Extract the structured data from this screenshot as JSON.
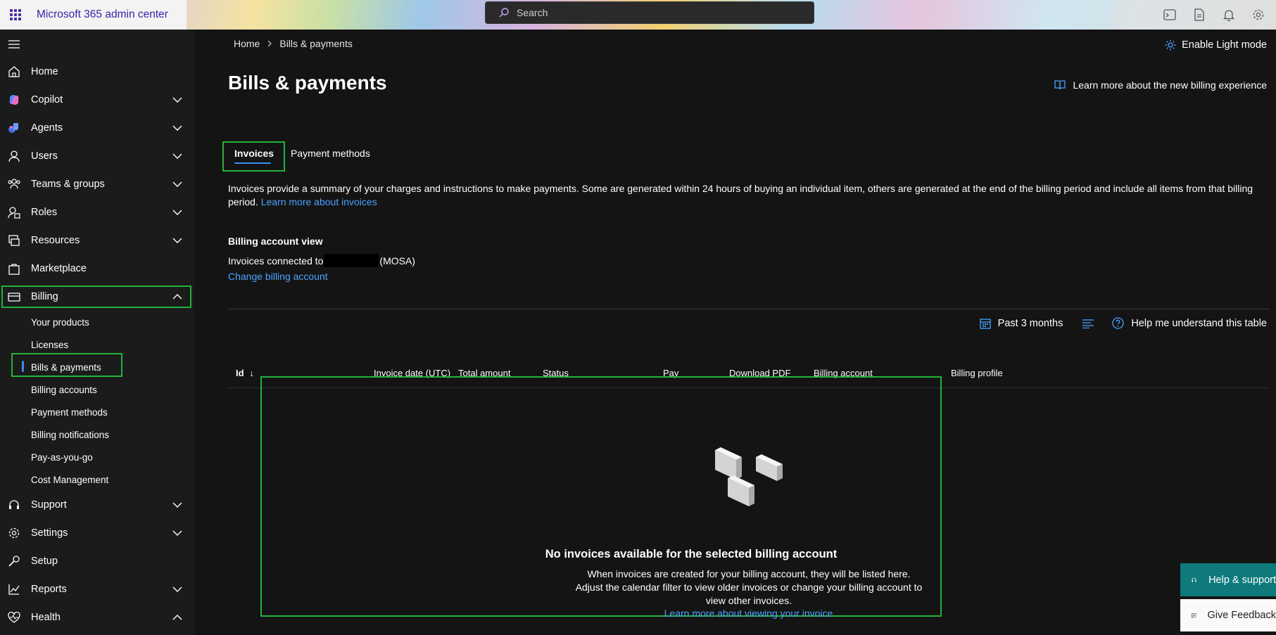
{
  "app": {
    "title": "Microsoft 365 admin center"
  },
  "search": {
    "placeholder": "Search"
  },
  "sidebar": {
    "items": [
      {
        "label": "Home"
      },
      {
        "label": "Copilot"
      },
      {
        "label": "Agents"
      },
      {
        "label": "Users"
      },
      {
        "label": "Teams & groups"
      },
      {
        "label": "Roles"
      },
      {
        "label": "Resources"
      },
      {
        "label": "Marketplace"
      },
      {
        "label": "Billing"
      },
      {
        "label": "Support"
      },
      {
        "label": "Settings"
      },
      {
        "label": "Setup"
      },
      {
        "label": "Reports"
      },
      {
        "label": "Health"
      }
    ],
    "billing_sub": [
      {
        "label": "Your products"
      },
      {
        "label": "Licenses"
      },
      {
        "label": "Bills & payments"
      },
      {
        "label": "Billing accounts"
      },
      {
        "label": "Payment methods"
      },
      {
        "label": "Billing notifications"
      },
      {
        "label": "Pay-as-you-go"
      },
      {
        "label": "Cost Management"
      }
    ]
  },
  "breadcrumb": {
    "home": "Home",
    "current": "Bills & payments"
  },
  "header": {
    "light_mode": "Enable Light mode",
    "learn_more_billing": "Learn more about the new billing experience",
    "title": "Bills & payments"
  },
  "tabs": [
    {
      "label": "Invoices",
      "selected": true
    },
    {
      "label": "Payment methods",
      "selected": false
    }
  ],
  "description": {
    "text": "Invoices provide a summary of your charges and instructions to make payments. Some are generated within 24 hours of buying an individual item, others are generated at the end of the billing period and include all items from that billing period. ",
    "link": "Learn more about invoices"
  },
  "account_view": {
    "title": "Billing account view",
    "prefix": "Invoices connected to",
    "suffix": "(MOSA)",
    "change_link": "Change billing account"
  },
  "filters": {
    "date_range": "Past 3 months",
    "help": "Help me understand this table"
  },
  "table": {
    "columns": [
      "Id",
      "Invoice date (UTC)",
      "Total amount",
      "Status",
      "Pay",
      "Download PDF",
      "Billing account",
      "Billing profile"
    ]
  },
  "empty_state": {
    "title": "No invoices available for the selected billing account",
    "text": "When invoices are created for your billing account, they will be listed here. Adjust the calendar filter to view older invoices or change your billing account to view other invoices.",
    "link": "Learn more about viewing your invoice"
  },
  "floating": {
    "help": "Help & support",
    "feedback": "Give Feedback"
  },
  "colors": {
    "accent": "#3a8ef0",
    "link": "#4aa3ff",
    "highlight_box": "#22b33a",
    "help_button": "#0e7a7c"
  }
}
